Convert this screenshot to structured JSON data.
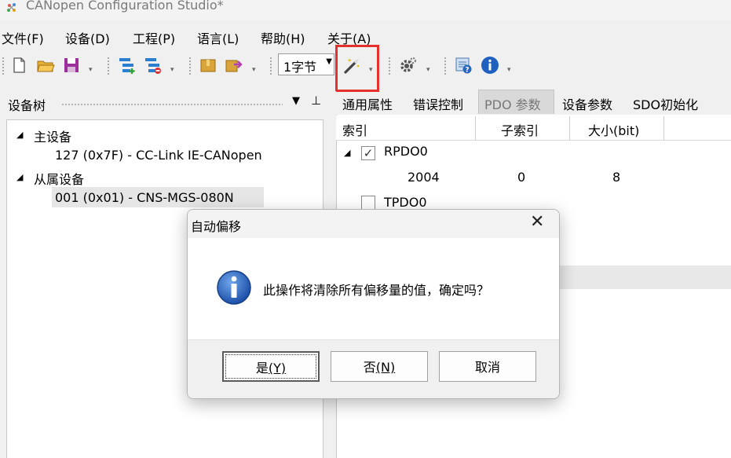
{
  "window": {
    "title": "CANopen Configuration Studio*"
  },
  "menu": [
    {
      "label": "文件(F)"
    },
    {
      "label": "设备(D)"
    },
    {
      "label": "工程(P)"
    },
    {
      "label": "语言(L)"
    },
    {
      "label": "帮助(H)"
    },
    {
      "label": "关于(A)"
    }
  ],
  "toolbar": {
    "byte_select_value": "1字节",
    "icons": [
      "new-file-icon",
      "open-folder-icon",
      "save-icon",
      "add-device-icon",
      "remove-device-icon",
      "import-icon",
      "export-icon",
      "auto-offset-wand-icon",
      "settings-gear-icon",
      "help-icon",
      "info-icon"
    ]
  },
  "device_tree": {
    "title": "设备树",
    "master_label": "主设备",
    "master_device": "127 (0x7F)  -  CC-Link IE-CANopen",
    "slave_label": "从属设备",
    "slave_device": "001 (0x01)  -  CNS-MGS-080N"
  },
  "tabs": [
    {
      "label": "通用属性"
    },
    {
      "label": "错误控制"
    },
    {
      "label": "PDO 参数",
      "active": true
    },
    {
      "label": "设备参数"
    },
    {
      "label": "SDO初始化"
    }
  ],
  "pdo_grid": {
    "headers": [
      "索引",
      "子索引",
      "大小(bit)"
    ],
    "rpdo": {
      "name": "RPDO0",
      "checked": true,
      "entry": {
        "index": "2004",
        "subindex": "0",
        "size": "8"
      }
    },
    "tpdo": {
      "name": "TPDO0",
      "checked": false
    }
  },
  "dialog": {
    "title": "自动偏移",
    "message": "此操作将清除所有偏移量的值，确定吗？",
    "yes_label": "是",
    "yes_key": "(Y)",
    "no_label": "否",
    "no_key": "(N)",
    "cancel_label": "取消"
  },
  "colors": {
    "highlight_box": "#e5312d",
    "info_icon": "#1f5fbf"
  }
}
